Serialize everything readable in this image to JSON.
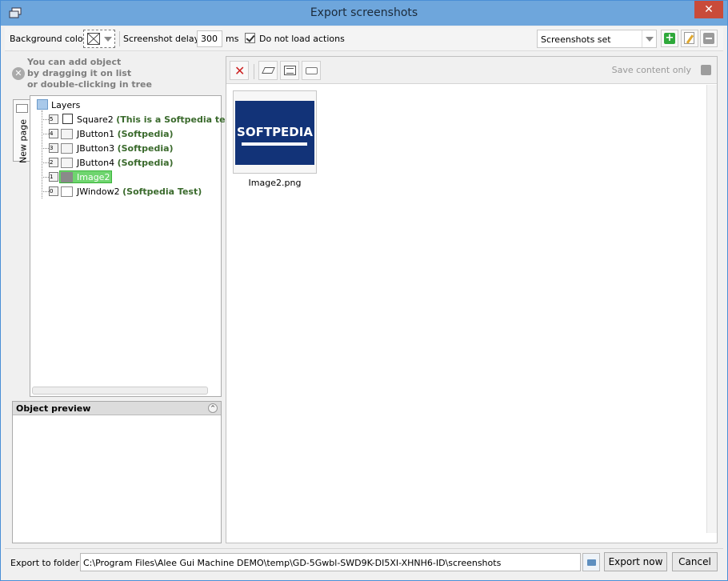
{
  "window": {
    "title": "Export screenshots",
    "close_glyph": "✕"
  },
  "toolbar": {
    "background_color_label": "Background color:",
    "screenshot_delay_label": "Screenshot delay:",
    "delay_value": "300",
    "delay_unit": "ms",
    "do_not_load_actions_label": "Do not load actions",
    "do_not_load_actions_checked": true,
    "screenshots_set_value": "Screenshots set",
    "add_glyph": "+"
  },
  "hint": {
    "text": "You can add object\nby dragging it on list\nor double-clicking in tree",
    "glyph": "✕"
  },
  "tab": {
    "label": "New page"
  },
  "tree": {
    "root": "Layers",
    "items": [
      {
        "index": "5",
        "name": "Square2",
        "tag": "(This is a Softpedia test!"
      },
      {
        "index": "4",
        "name": "JButton1",
        "tag": "(Softpedia)"
      },
      {
        "index": "3",
        "name": "JButton3",
        "tag": "(Softpedia)"
      },
      {
        "index": "2",
        "name": "JButton4",
        "tag": "(Softpedia)"
      },
      {
        "index": "1",
        "name": "Image2",
        "tag": ""
      },
      {
        "index": "0",
        "name": "JWindow2",
        "tag": "(Softpedia Test)"
      }
    ]
  },
  "preview": {
    "title": "Object preview",
    "collapse_glyph": "^"
  },
  "right": {
    "delete_glyph": "✕",
    "save_content_only_label": "Save content only",
    "thumb_brand": "SOFTPEDIA",
    "thumb_caption": "Image2.png"
  },
  "bottom": {
    "export_label": "Export to folder:",
    "path": "C:\\Program Files\\Alee Gui Machine DEMO\\temp\\GD-5Gwbl-SWD9K-DI5XI-XHNH6-ID\\screenshots",
    "export_button": "Export now",
    "cancel_button": "Cancel"
  },
  "colors": {
    "titlebar": "#6ea6dc",
    "selected": "#6fd56f",
    "tag_text": "#3a6a2c",
    "thumb_bg": "#123378"
  }
}
